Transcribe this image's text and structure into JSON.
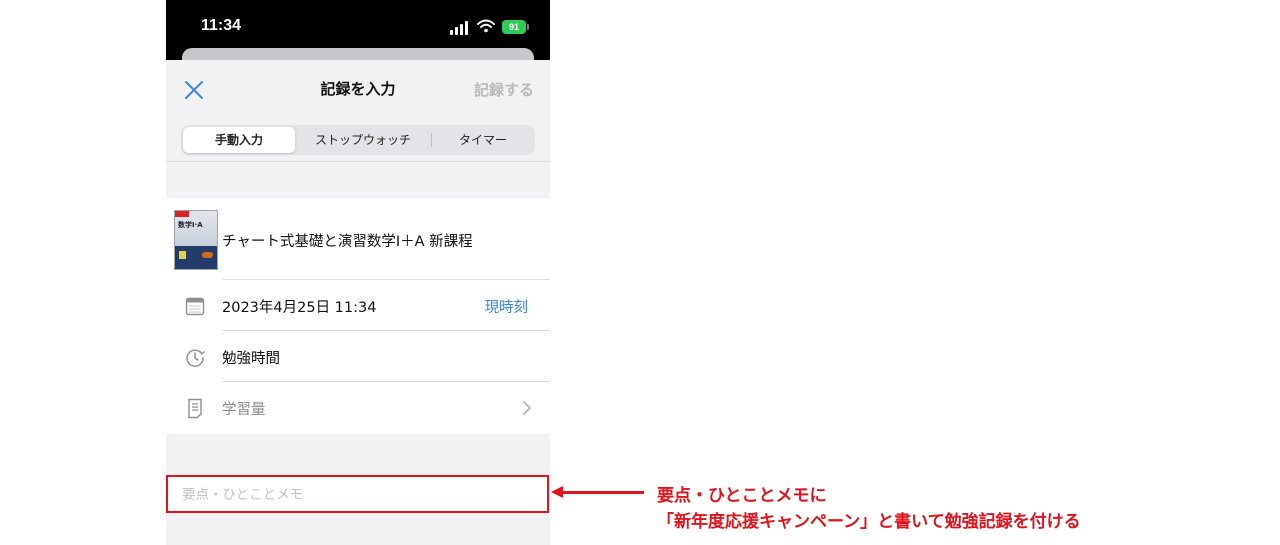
{
  "status_bar": {
    "time": "11:34",
    "battery": "91"
  },
  "nav": {
    "title": "記録を入力",
    "record_button": "記録する"
  },
  "segments": [
    "手動入力",
    "ストップウォッチ",
    "タイマー"
  ],
  "book": {
    "title": "チャート式基礎と演習数学I＋A 新課程",
    "cover_text": "数学I·A"
  },
  "date_row": {
    "value": "2023年4月25日 11:34",
    "now_button": "現時刻"
  },
  "study_time_row": {
    "label": "勉強時間"
  },
  "amount_row": {
    "label": "学習量"
  },
  "memo": {
    "placeholder": "要点・ひとことメモ"
  },
  "annotation": {
    "line1": "要点・ひとことメモに",
    "line2": "「新年度応援キャンペーン」と書いて勉強記録を付ける"
  },
  "colors": {
    "accent_blue": "#3a86d9",
    "annotation_red": "#e0141c",
    "battery_green": "#2ecc55"
  },
  "icons": [
    "close-icon",
    "calendar-icon",
    "clock-icon",
    "document-icon",
    "chevron-right-icon",
    "wifi-icon",
    "signal-icon",
    "battery-icon"
  ]
}
